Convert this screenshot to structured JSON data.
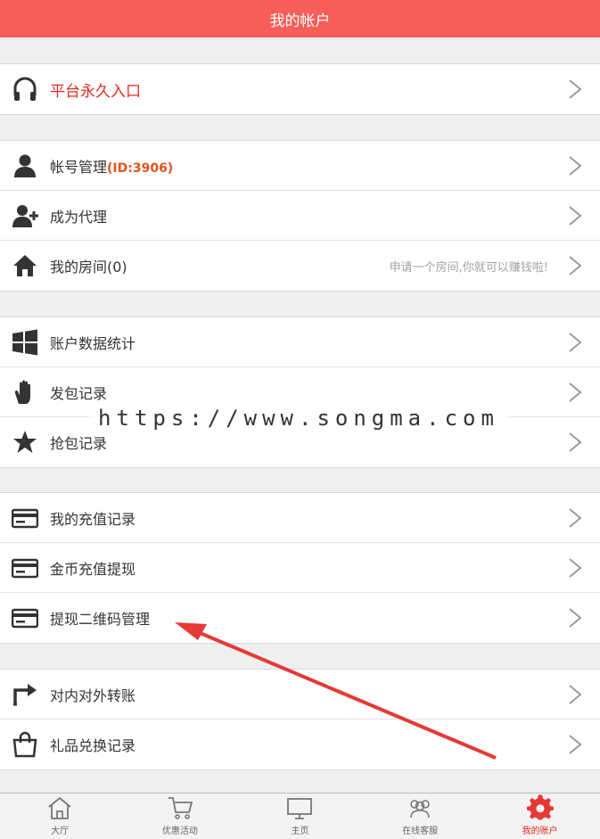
{
  "header": {
    "title": "我的帐户"
  },
  "groups": [
    {
      "items": [
        {
          "label": "平台永久入口",
          "icon": "headphones-icon"
        }
      ]
    },
    {
      "items": [
        {
          "label": "帐号管理",
          "suffix": "(ID:3906)",
          "icon": "user-icon"
        },
        {
          "label": "成为代理",
          "icon": "user-add-icon"
        },
        {
          "label": "我的房间(0)",
          "hint": "申请一个房间,你就可以赚钱啦!",
          "icon": "home-icon"
        }
      ]
    },
    {
      "items": [
        {
          "label": "账户数据统计",
          "icon": "windows-icon"
        },
        {
          "label": "发包记录",
          "icon": "hand-icon"
        },
        {
          "label": "抢包记录",
          "icon": "star-icon"
        }
      ]
    },
    {
      "items": [
        {
          "label": "我的充值记录",
          "icon": "card-icon"
        },
        {
          "label": "金币充值提现",
          "icon": "card-icon"
        },
        {
          "label": "提现二维码管理",
          "icon": "card-icon"
        }
      ]
    },
    {
      "items": [
        {
          "label": "对内对外转账",
          "icon": "transfer-icon"
        },
        {
          "label": "礼品兑换记录",
          "icon": "bag-icon"
        }
      ]
    }
  ],
  "watermark": "https://www.songma.com",
  "tabbar": [
    {
      "label": "大厅",
      "icon": "hall-icon"
    },
    {
      "label": "优惠活动",
      "icon": "cart-icon"
    },
    {
      "label": "主页",
      "icon": "monitor-icon"
    },
    {
      "label": "在线客服",
      "icon": "support-icon"
    },
    {
      "label": "我的账户",
      "icon": "gear-icon",
      "active": true
    }
  ],
  "colors": {
    "header": "#f75d59",
    "accent": "#e02a1e",
    "id_suffix": "#e4531c"
  }
}
